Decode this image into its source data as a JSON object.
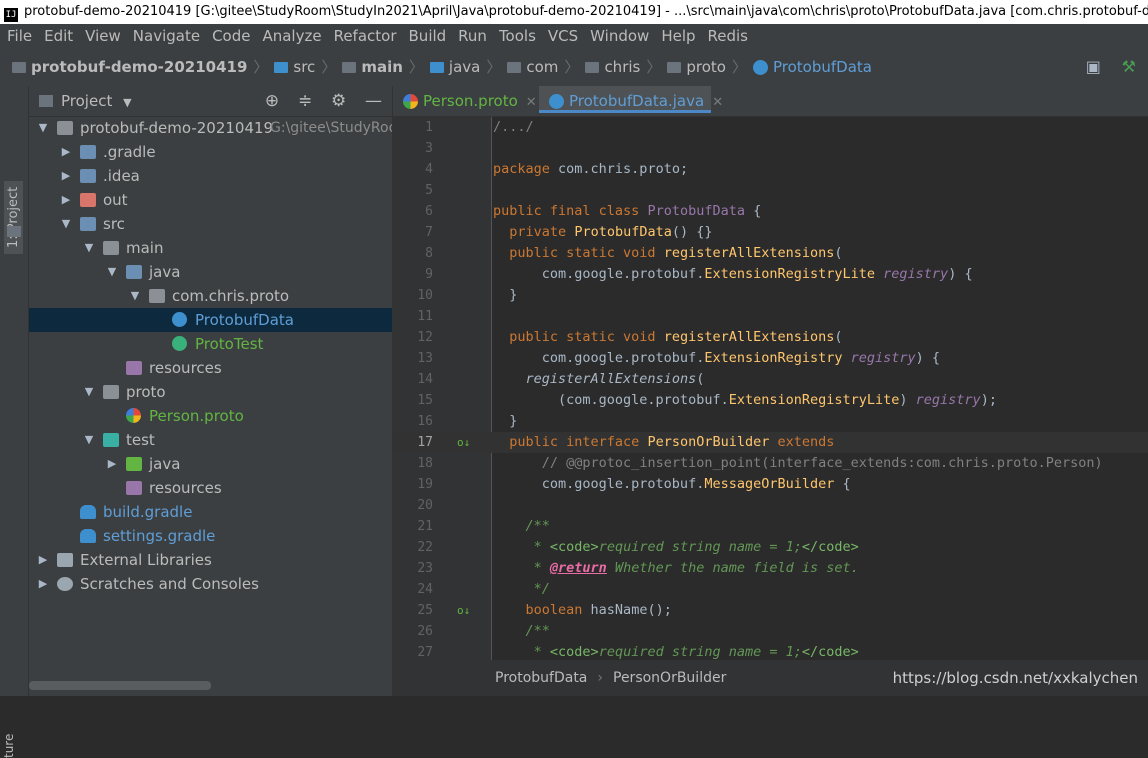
{
  "window": {
    "title": "protobuf-demo-20210419 [G:\\gitee\\StudyRoom\\StudyIn2021\\April\\Java\\protobuf-demo-20210419] - ...\\src\\main\\java\\com\\chris\\proto\\ProtobufData.java [com.chris.protobuf-demo-20210419.ma"
  },
  "menu": [
    "File",
    "Edit",
    "View",
    "Navigate",
    "Code",
    "Analyze",
    "Refactor",
    "Build",
    "Run",
    "Tools",
    "VCS",
    "Window",
    "Help",
    "Redis"
  ],
  "breadcrumb": {
    "project": "protobuf-demo-20210419",
    "items": [
      "src",
      "main",
      "java",
      "com",
      "chris",
      "proto"
    ],
    "file": "ProtobufData"
  },
  "sidebar_tab": {
    "label": "1: Project",
    "bottom_label": "ture"
  },
  "project_panel": {
    "header": "Project",
    "tree": [
      {
        "label": "protobuf-demo-20210419",
        "path": "G:\\gitee\\StudyRoom",
        "depth": 0,
        "arrow": "open",
        "icon": "gray"
      },
      {
        "label": ".gradle",
        "depth": 1,
        "arrow": "closed",
        "icon": "folder"
      },
      {
        "label": ".idea",
        "depth": 1,
        "arrow": "closed",
        "icon": "folder"
      },
      {
        "label": "out",
        "depth": 1,
        "arrow": "closed",
        "icon": "orange"
      },
      {
        "label": "src",
        "depth": 1,
        "arrow": "open",
        "icon": "src"
      },
      {
        "label": "main",
        "depth": 2,
        "arrow": "open",
        "icon": "gray"
      },
      {
        "label": "java",
        "depth": 3,
        "arrow": "open",
        "icon": "folder"
      },
      {
        "label": "com.chris.proto",
        "depth": 4,
        "arrow": "open",
        "icon": "gray"
      },
      {
        "label": "ProtobufData",
        "depth": 5,
        "arrow": "",
        "icon": "cls",
        "color": "blue",
        "selected": true
      },
      {
        "label": "ProtoTest",
        "depth": 5,
        "arrow": "",
        "icon": "clsg",
        "color": "green"
      },
      {
        "label": "resources",
        "depth": 3,
        "arrow": "",
        "icon": "purple"
      },
      {
        "label": "proto",
        "depth": 2,
        "arrow": "open",
        "icon": "gray"
      },
      {
        "label": "Person.proto",
        "depth": 3,
        "arrow": "",
        "icon": "proto",
        "color": "green"
      },
      {
        "label": "test",
        "depth": 2,
        "arrow": "open",
        "icon": "teal"
      },
      {
        "label": "java",
        "depth": 3,
        "arrow": "closed",
        "icon": "green"
      },
      {
        "label": "resources",
        "depth": 3,
        "arrow": "",
        "icon": "purple"
      },
      {
        "label": "build.gradle",
        "depth": 1,
        "arrow": "",
        "icon": "gradle",
        "color": "blue"
      },
      {
        "label": "settings.gradle",
        "depth": 1,
        "arrow": "",
        "icon": "gradle",
        "color": "blue"
      },
      {
        "label": "External Libraries",
        "depth": 0,
        "arrow": "closed",
        "icon": "lib"
      },
      {
        "label": "Scratches and Consoles",
        "depth": 0,
        "arrow": "closed",
        "icon": "scr"
      }
    ]
  },
  "editor_tabs": [
    {
      "label": "Person.proto",
      "active": false,
      "color": "#62b543"
    },
    {
      "label": "ProtobufData.java",
      "active": true,
      "color": "#5f9ed6"
    }
  ],
  "code": {
    "current_line": 17,
    "lines": [
      {
        "n": "1",
        "html": "<span class=\"cmt\">/.../</span>"
      },
      {
        "n": "3",
        "html": ""
      },
      {
        "n": "4",
        "html": "<span class=\"kw\">package</span> com.chris.proto;"
      },
      {
        "n": "5",
        "html": ""
      },
      {
        "n": "6",
        "html": "<span class=\"kw\">public final class</span> <span class=\"pur\">ProtobufData</span> {"
      },
      {
        "n": "7",
        "html": "  <span class=\"kw\">private</span> <span class=\"fn\">ProtobufData</span>() {}"
      },
      {
        "n": "8",
        "html": "  <span class=\"kw\">public static void</span> <span class=\"fn\">registerAllExtensions</span>("
      },
      {
        "n": "9",
        "html": "      com.google.protobuf.<span class=\"fn\">ExtensionRegistryLite</span> <span class=\"pur it\">registry</span>) {"
      },
      {
        "n": "10",
        "html": "  }"
      },
      {
        "n": "11",
        "html": ""
      },
      {
        "n": "12",
        "html": "  <span class=\"kw\">public static void</span> <span class=\"fn\">registerAllExtensions</span>("
      },
      {
        "n": "13",
        "html": "      com.google.protobuf.<span class=\"fn\">ExtensionRegistry</span> <span class=\"pur it\">registry</span>) {"
      },
      {
        "n": "14",
        "html": "    <span class=\"it\">registerAllExtensions</span>("
      },
      {
        "n": "15",
        "html": "        (com.google.protobuf.<span class=\"fn\">ExtensionRegistryLite</span>) <span class=\"pur it\">registry</span>);"
      },
      {
        "n": "16",
        "html": "  }"
      },
      {
        "n": "17",
        "html": "  <span class=\"kw\">public interface</span> <span class=\"fn\">PersonOrBuilder</span> <span class=\"kw\">extends</span>",
        "mark": "o↓"
      },
      {
        "n": "18",
        "html": "      <span class=\"cmt\">// @@protoc_insertion_point(interface_extends:com.chris.proto.Person)</span>"
      },
      {
        "n": "19",
        "html": "      com.google.protobuf.<span class=\"fn\">MessageOrBuilder</span> {"
      },
      {
        "n": "20",
        "html": ""
      },
      {
        "n": "21",
        "html": "    <span class=\"doc\">/**</span>"
      },
      {
        "n": "22",
        "html": "     <span class=\"doc\">* </span><span class=\"tag\">&lt;code&gt;</span><span class=\"doc\">required string name = 1;</span><span class=\"tag\">&lt;/code&gt;</span>"
      },
      {
        "n": "23",
        "html": "     <span class=\"doc\">* </span><span class=\"jdt\">@return</span><span class=\"doc\"> Whether the name field is set.</span>"
      },
      {
        "n": "24",
        "html": "     <span class=\"doc\">*/</span>"
      },
      {
        "n": "25",
        "html": "    <span class=\"kw\">boolean</span> hasName();",
        "mark": "o↓"
      },
      {
        "n": "26",
        "html": "    <span class=\"doc\">/**</span>"
      },
      {
        "n": "27",
        "html": "     <span class=\"doc\">* </span><span class=\"tag\">&lt;code&gt;</span><span class=\"doc\">required string name = 1;</span><span class=\"tag\">&lt;/code&gt;</span>"
      }
    ]
  },
  "status": {
    "breadcrumb": [
      "ProtobufData",
      "PersonOrBuilder"
    ],
    "watermark": "https://blog.csdn.net/xxkalychen"
  },
  "icons": {
    "run_config": "terminal-icon",
    "build": "hammer-icon",
    "locate": "crosshair-icon",
    "collapse": "collapse-icon",
    "settings": "gear-icon",
    "hide": "minimize-icon"
  }
}
